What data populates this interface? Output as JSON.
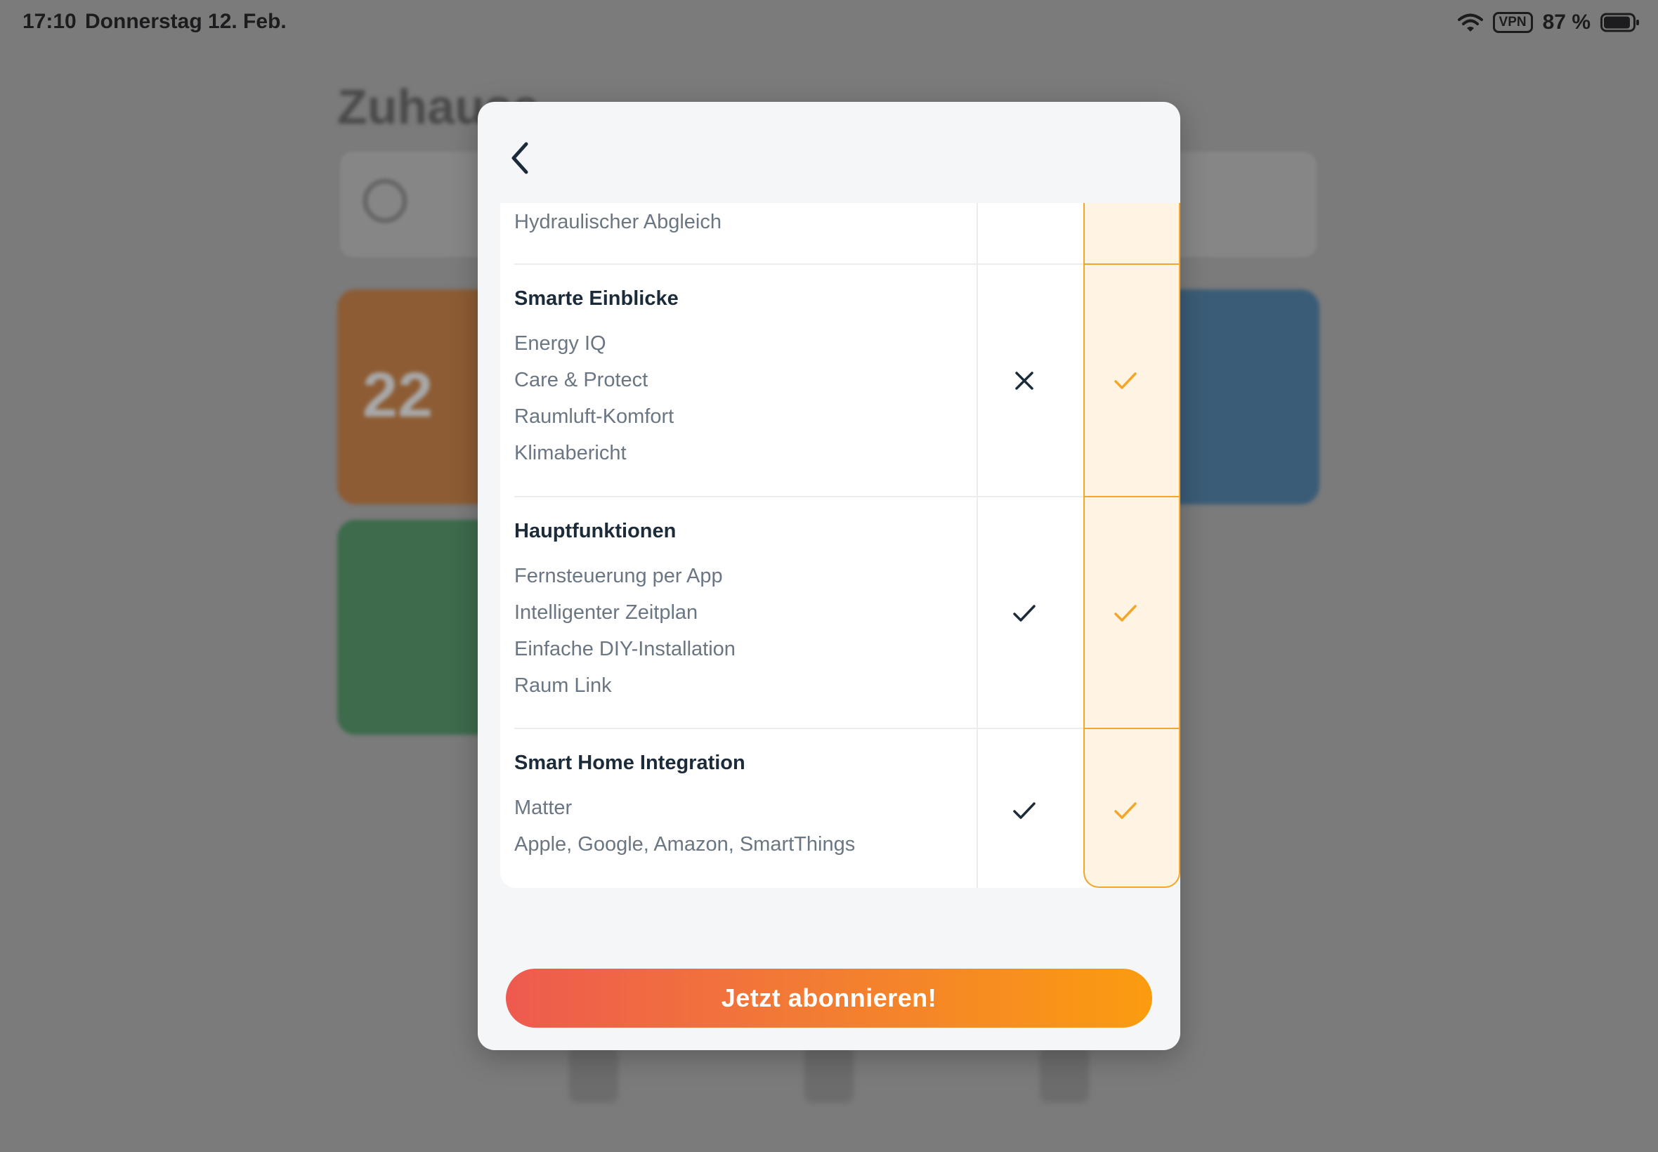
{
  "status_bar": {
    "time": "17:10",
    "date": "Donnerstag 12. Feb.",
    "vpn": "VPN",
    "battery": "87 %"
  },
  "background": {
    "title": "Zuhause",
    "temp": "22"
  },
  "modal": {
    "back_icon": "chevron-left-icon",
    "partial_row": {
      "item": "Hydraulischer Abgleich"
    },
    "sections": [
      {
        "title": "Smarte Einblicke",
        "items": [
          "Energy IQ",
          "Care & Protect",
          "Raumluft-Komfort",
          "Klimabericht"
        ],
        "free": "cross",
        "premium": "check"
      },
      {
        "title": "Hauptfunktionen",
        "items": [
          "Fernsteuerung per App",
          "Intelligenter Zeitplan",
          "Einfache DIY-Installation",
          "Raum Link"
        ],
        "free": "check",
        "premium": "check"
      },
      {
        "title": "Smart Home Integration",
        "items": [
          "Matter",
          "Apple, Google, Amazon, SmartThings"
        ],
        "free": "check",
        "premium": "check"
      }
    ],
    "cta_label": "Jetzt abonnieren!"
  },
  "colors": {
    "accent_orange": "#f3a629",
    "navy": "#1c2b3a",
    "cta_start": "#ee5a4f",
    "cta_end": "#fb9c0f"
  }
}
